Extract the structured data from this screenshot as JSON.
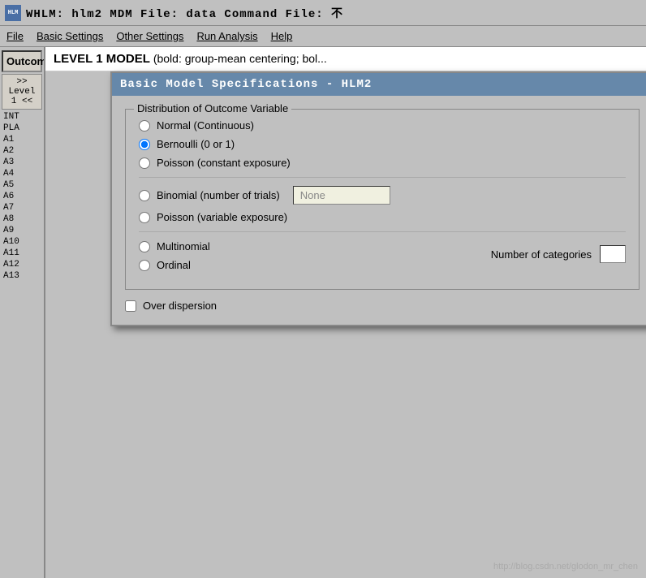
{
  "titleBar": {
    "iconText": "HLM",
    "title": "WHLM: hlm2  MDM  File: data    Command File: 不"
  },
  "menuBar": {
    "items": [
      {
        "label": "File",
        "id": "file"
      },
      {
        "label": "Basic Settings",
        "id": "basic-settings"
      },
      {
        "label": "Other Settings",
        "id": "other-settings"
      },
      {
        "label": "Run Analysis",
        "id": "run-analysis"
      },
      {
        "label": "Help",
        "id": "help"
      }
    ]
  },
  "sidebar": {
    "outcomeLabel": "Outcome",
    "levelLabel": ">> Level 1 <<",
    "variables": [
      "INT",
      "PLA",
      "A1",
      "A2",
      "A3",
      "A4",
      "A5",
      "A6",
      "A7",
      "A8",
      "A9",
      "A10",
      "A11",
      "A12",
      "A13"
    ]
  },
  "levelHeader": {
    "boldText": "LEVEL 1 MODEL",
    "normalText": " (bold: group-mean centering; bol..."
  },
  "dialog": {
    "title": "Basic Model Specifications - HLM2",
    "groupBoxLabel": "Distribution of Outcome Variable",
    "options": [
      {
        "id": "normal",
        "label": "Normal (Continuous)",
        "checked": false
      },
      {
        "id": "bernoulli",
        "label": "Bernoulli  (0 or 1)",
        "checked": true
      },
      {
        "id": "poisson-const",
        "label": "Poisson (constant exposure)",
        "checked": false
      },
      {
        "id": "binomial",
        "label": "Binomial (number of trials)",
        "checked": false
      },
      {
        "id": "poisson-var",
        "label": "Poisson (variable exposure)",
        "checked": false
      },
      {
        "id": "multinomial",
        "label": "Multinomial",
        "checked": false
      },
      {
        "id": "ordinal",
        "label": "Ordinal",
        "checked": false
      }
    ],
    "dropdownValue": "None",
    "numberOfCategoriesLabel": "Number of categories",
    "overDispersionLabel": "Over dispersion"
  },
  "watermark": "http://blog.csdn.net/glodon_mr_chen"
}
